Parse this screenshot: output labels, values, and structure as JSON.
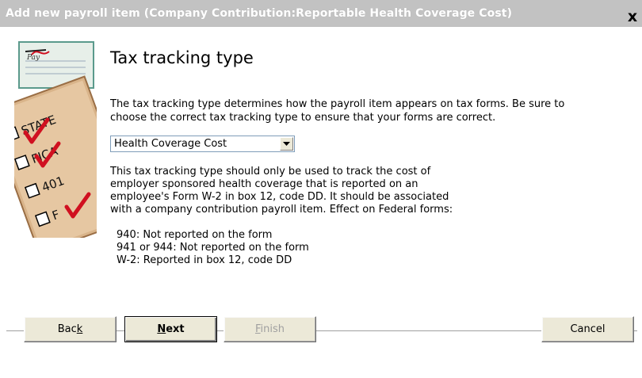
{
  "window": {
    "title": "Add new payroll item (Company Contribution:Reportable Health Coverage Cost)",
    "close_glyph": "x"
  },
  "page": {
    "heading": "Tax tracking type",
    "intro_line1": "The tax tracking type determines how the payroll item appears on tax forms.  Be sure to",
    "intro_line2": "choose the correct tax tracking type to ensure that your forms are correct."
  },
  "tax_tracking_select": {
    "selected_value": "Health Coverage Cost"
  },
  "description": {
    "line1": "This tax tracking type should only be used to track the cost of",
    "line2": "employer sponsored health coverage that is reported on an",
    "line3": "employee's Form W-2 in box 12, code DD.  It should be associated",
    "line4": "with a company contribution payroll item. Effect on Federal forms:",
    "effect1": "940: Not reported on the form",
    "effect2": "941 or 944: Not reported on the form",
    "effect3": "W-2: Reported in box 12, code DD"
  },
  "buttons": {
    "back": "Back",
    "back_mnemonic": "k",
    "next": "Next",
    "next_mnemonic": "N",
    "finish": "Finish",
    "finish_mnemonic": "F",
    "cancel": "Cancel"
  },
  "illustration": {
    "labels": [
      "STATE",
      "FICA",
      "401",
      "F"
    ],
    "pay_label": "Pay"
  },
  "colors": {
    "title_bar": "#c2c2c2",
    "checkmark_red": "#d01020",
    "form_tan": "#d9b48a",
    "form_teal": "#5b9a8c"
  }
}
